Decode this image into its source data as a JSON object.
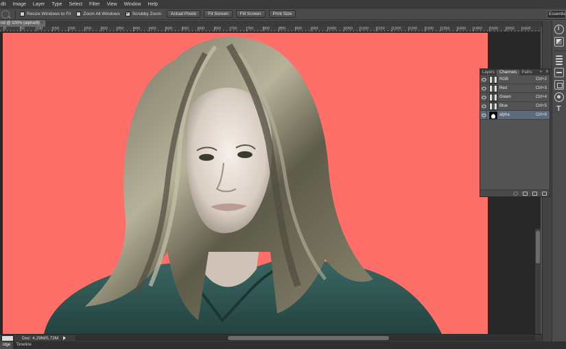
{
  "menu": [
    "dit",
    "Image",
    "Layer",
    "Type",
    "Select",
    "Filter",
    "View",
    "Window",
    "Help"
  ],
  "options": {
    "checkboxes": [
      {
        "label": "Resize Windows to Fit",
        "checked": false
      },
      {
        "label": "Zoom All Windows",
        "checked": false
      },
      {
        "label": "Scrubby Zoom",
        "checked": true
      }
    ],
    "buttons": [
      "Actual Pixels",
      "Fit Screen",
      "Fill Screen",
      "Print Size"
    ],
    "workspace": "Essentials"
  },
  "document": {
    "tab_title": "nd @ 100% (alpha/8)",
    "close_glyph": "×",
    "status": "Doc: 4,29M/5,72M"
  },
  "ruler_labels": [
    "0",
    "50",
    "100",
    "150",
    "200",
    "250",
    "300",
    "350",
    "400",
    "450",
    "500",
    "550",
    "600",
    "650",
    "700",
    "750",
    "800",
    "850",
    "900",
    "950",
    "1000",
    "1050",
    "1100",
    "1150",
    "1200",
    "1250",
    "1300",
    "1350",
    "1400",
    "1450",
    "1500",
    "1550",
    "1600"
  ],
  "channels_panel": {
    "tabs": [
      "Layers",
      "Channels",
      "Paths"
    ],
    "active_tab": "Channels",
    "collapse_glyph": "»",
    "menu_glyph": "≡",
    "rows": [
      {
        "name": "RGB",
        "shortcut": "Ctrl+2",
        "visible": true
      },
      {
        "name": "Red",
        "shortcut": "Ctrl+3",
        "visible": true
      },
      {
        "name": "Green",
        "shortcut": "Ctrl+4",
        "visible": true
      },
      {
        "name": "Blue",
        "shortcut": "Ctrl+5",
        "visible": true
      },
      {
        "name": "alpha",
        "shortcut": "Ctrl+6",
        "visible": true,
        "selected": true
      }
    ]
  },
  "bottom_tabs": [
    "idge",
    "Timeline"
  ],
  "colors": {
    "background_coral": "#ff6f6a",
    "shirt_teal": "#2f5a57",
    "selected_row": "#5d6b7d"
  },
  "icons": [
    "zoom-tool-icon",
    "info-icon",
    "navigator-icon",
    "histogram-icon",
    "adjustments-icon",
    "styles-icon",
    "color-icon",
    "type-icon"
  ]
}
